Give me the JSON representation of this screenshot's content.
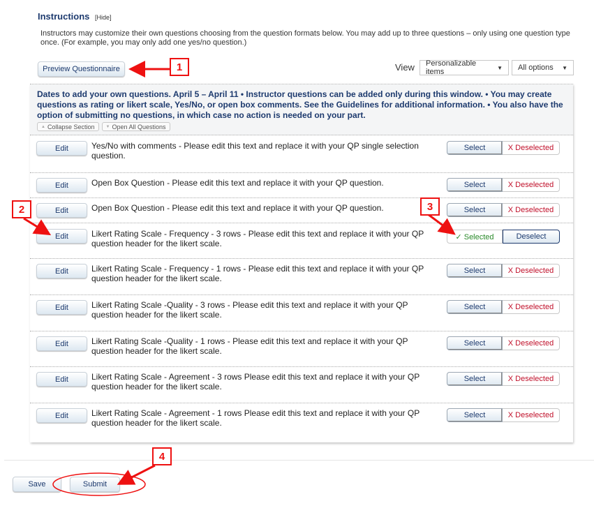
{
  "instructions": {
    "title": "Instructions",
    "hide_link": "[Hide]",
    "text": "Instructors may customize their own questions choosing from the question formats below. You may add up to three questions – only using one question type once. (For example, you may only add one yes/no question.)"
  },
  "toolbar": {
    "preview_label": "Preview Questionnaire",
    "view_label": "View",
    "view_select": "Personalizable items",
    "options_select": "All options",
    "caret_icon": "▼"
  },
  "panel": {
    "header_text": "Dates to add your own questions. April 5 – April 11 • Instructor questions can be added only during this window. • You may create questions as rating or likert scale, Yes/No, or open box comments. See the Guidelines for additional information. • You also have the option of submitting no questions, in which case no action is needed on your part.",
    "collapse_label": "Collapse Section",
    "open_all_label": "Open All Questions",
    "up_icon": "▲",
    "down_icon": "▼"
  },
  "questions": [
    {
      "edit": "Edit",
      "text": "Yes/No with comments - Please edit this text and replace it with your QP single selection question.",
      "state": "deselected",
      "select": "Select",
      "deselected": "X Deselected"
    },
    {
      "edit": "Edit",
      "text": "Open Box Question - Please edit this text and replace it with your QP question.",
      "state": "deselected",
      "select": "Select",
      "deselected": "X Deselected"
    },
    {
      "edit": "Edit",
      "text": "Open Box Question - Please edit this text and replace it with your QP question.",
      "state": "deselected",
      "select": "Select",
      "deselected": "X Deselected"
    },
    {
      "edit": "Edit",
      "text": "Likert Rating Scale - Frequency - 3 rows - Please edit this text and replace it with your QP question header for the likert scale.",
      "state": "selected",
      "selected": "✓ Selected",
      "deselect": "Deselect"
    },
    {
      "edit": "Edit",
      "text": "Likert Rating Scale - Frequency - 1 rows - Please edit this text and replace it with your QP question header for the likert scale.",
      "state": "deselected",
      "select": "Select",
      "deselected": "X Deselected"
    },
    {
      "edit": "Edit",
      "text": "Likert Rating Scale -Quality - 3 rows - Please edit this text and replace it with your QP question header for the likert scale.",
      "state": "deselected",
      "select": "Select",
      "deselected": "X Deselected"
    },
    {
      "edit": "Edit",
      "text": "Likert Rating Scale -Quality - 1 rows - Please edit this text and replace it with your QP question header for the likert scale.",
      "state": "deselected",
      "select": "Select",
      "deselected": "X Deselected"
    },
    {
      "edit": "Edit",
      "text": "Likert Rating Scale - Agreement - 3 rows Please edit this text and replace it with your QP question header for the likert scale.",
      "state": "deselected",
      "select": "Select",
      "deselected": "X Deselected"
    },
    {
      "edit": "Edit",
      "text": "Likert Rating Scale - Agreement - 1 rows Please edit this text and replace it with your QP question header for the likert scale.",
      "state": "deselected",
      "select": "Select",
      "deselected": "X Deselected"
    }
  ],
  "footer": {
    "save_label": "Save",
    "submit_label": "Submit"
  },
  "callouts": [
    "1",
    "2",
    "3",
    "4"
  ],
  "colors": {
    "brand_navy": "#1d3a6e",
    "annotation_red": "#e11111",
    "deselected_red": "#c0102a",
    "selected_green": "#2a8a2a"
  }
}
